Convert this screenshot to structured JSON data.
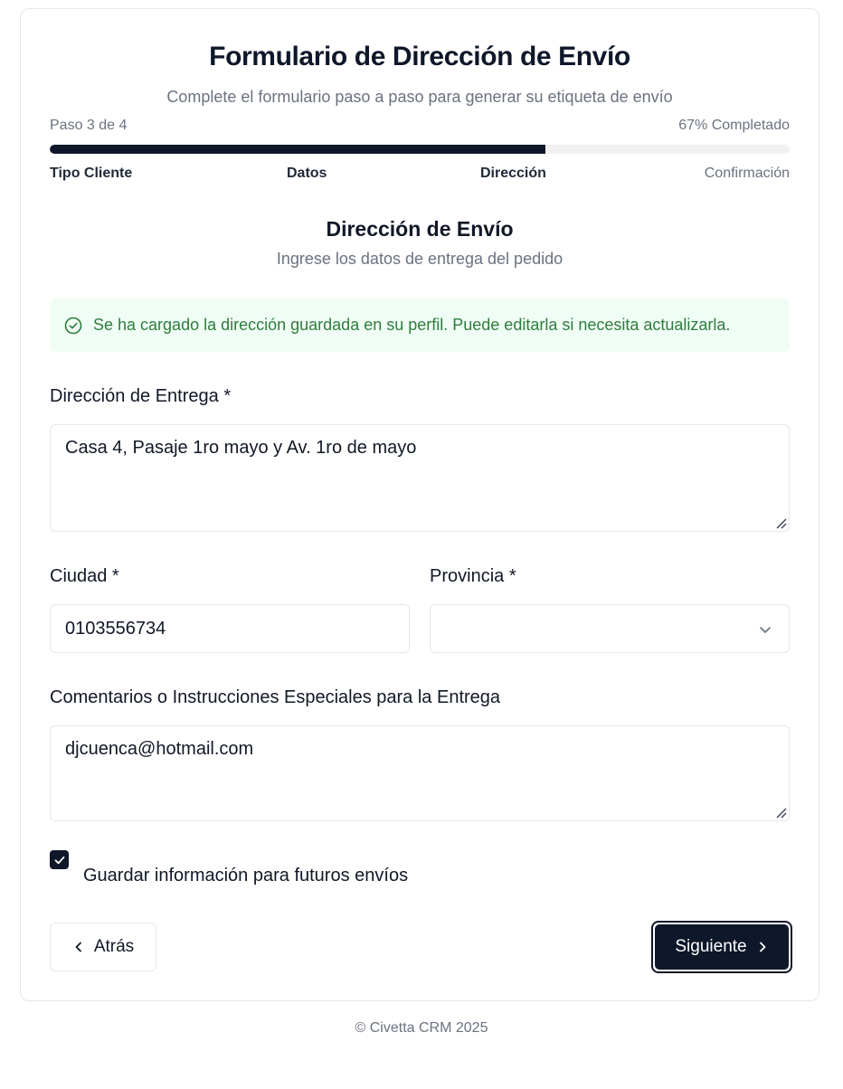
{
  "header": {
    "title": "Formulario de Dirección de Envío",
    "subtitle": "Complete el formulario paso a paso para generar su etiqueta de envío"
  },
  "progress": {
    "step_text": "Paso 3 de 4",
    "percent_text": "67% Completado",
    "percent": 67,
    "steps": [
      "Tipo Cliente",
      "Datos",
      "Dirección",
      "Confirmación"
    ]
  },
  "section": {
    "title": "Dirección de Envío",
    "subtitle": "Ingrese los datos de entrega del pedido"
  },
  "alert": {
    "icon": "check-circle-icon",
    "text": "Se ha cargado la dirección guardada en su perfil. Puede editarla si necesita actualizarla."
  },
  "fields": {
    "address_label": "Dirección de Entrega *",
    "address_value": "Casa 4, Pasaje 1ro mayo y Av. 1ro de mayo",
    "city_label": "Ciudad *",
    "city_value": "0103556734",
    "province_label": "Provincia *",
    "province_value": "",
    "comments_label": "Comentarios o Instrucciones Especiales para la Entrega",
    "comments_value": "djcuenca@hotmail.com"
  },
  "save_checkbox": {
    "checked": true,
    "label": "Guardar información para futuros envíos"
  },
  "buttons": {
    "back": "Atrás",
    "next": "Siguiente"
  },
  "footer": "© Civetta CRM 2025",
  "colors": {
    "primary": "#0f172a",
    "success_bg": "#f0fdf4",
    "success_text": "#2e7d3d",
    "muted": "#6b7280"
  }
}
